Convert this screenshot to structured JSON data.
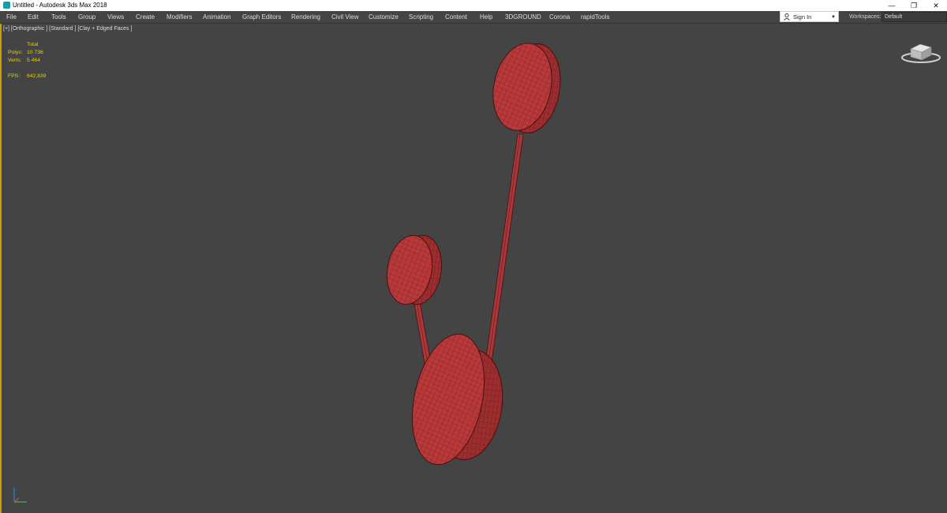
{
  "window": {
    "title": "Untitled - Autodesk 3ds Max 2018",
    "controls": {
      "minimize": "—",
      "restore": "❐",
      "close": "✕"
    }
  },
  "menu": {
    "items": [
      "File",
      "Edit",
      "Tools",
      "Group",
      "Views",
      "Create",
      "Modifiers",
      "Animation",
      "Graph Editors",
      "Rendering",
      "Civil View",
      "Customize",
      "Scripting",
      "Content",
      "Help",
      "3DGROUND",
      "Corona",
      "rapidTools"
    ]
  },
  "account": {
    "sign_in": "Sign In"
  },
  "workspaces": {
    "label": "Workspaces:",
    "value": "Default"
  },
  "viewport": {
    "label": "[+] [Orthographic ] [Standard ] [Clay + Edged Faces ]",
    "stats": {
      "total_label": "Total",
      "polys_label": "Polys:",
      "polys_value": "10 736",
      "verts_label": "Verts:",
      "verts_value": "5 464",
      "fps_label": "FPS:",
      "fps_value": "642,839"
    }
  },
  "colors": {
    "mesh": "#b8393a",
    "mesh_dark": "#7c1d1e",
    "viewport_bg": "#444444",
    "active_border": "#c8a000",
    "stats_text": "#e8d000"
  },
  "icons": {
    "viewcube": "viewcube-icon",
    "axis": "axis-tripod-icon",
    "user": "user-icon"
  }
}
